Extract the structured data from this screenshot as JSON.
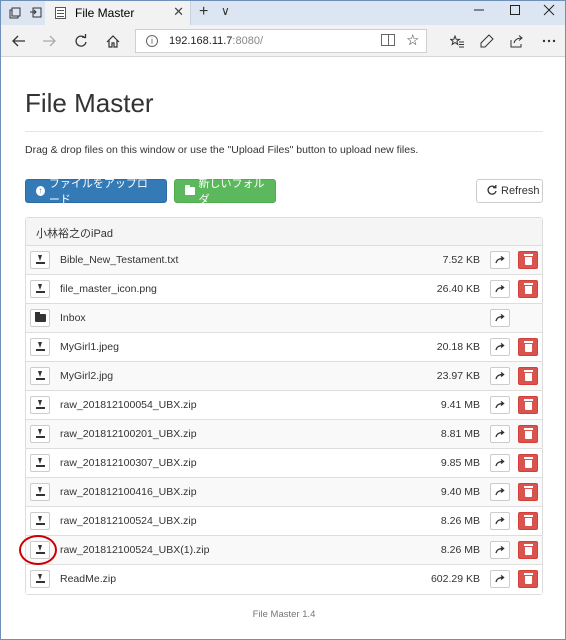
{
  "browser": {
    "tab_title": "File Master",
    "tab_close": "✕",
    "new_tab": "+",
    "tab_menu": "∨",
    "url_host": "192.168.11.7",
    "url_port": ":8080/",
    "info_glyph": "i"
  },
  "page": {
    "title": "File Master",
    "hint": "Drag & drop files on this window or use the \"Upload Files\" button to upload new files.",
    "upload_label": "ファイルをアップロード",
    "new_folder_label": "新しいフォルダ",
    "refresh_label": "Refresh",
    "panel_heading": "小林裕之のiPad",
    "footer": "File Master 1.4"
  },
  "files": [
    {
      "name": "Bible_New_Testament.txt",
      "size": "7.52 KB",
      "type": "file"
    },
    {
      "name": "file_master_icon.png",
      "size": "26.40 KB",
      "type": "file"
    },
    {
      "name": "Inbox",
      "size": "",
      "type": "folder"
    },
    {
      "name": "MyGirl1.jpeg",
      "size": "20.18 KB",
      "type": "file"
    },
    {
      "name": "MyGirl2.jpg",
      "size": "23.97 KB",
      "type": "file"
    },
    {
      "name": "raw_201812100054_UBX.zip",
      "size": "9.41 MB",
      "type": "file"
    },
    {
      "name": "raw_201812100201_UBX.zip",
      "size": "8.81 MB",
      "type": "file"
    },
    {
      "name": "raw_201812100307_UBX.zip",
      "size": "9.85 MB",
      "type": "file"
    },
    {
      "name": "raw_201812100416_UBX.zip",
      "size": "9.40 MB",
      "type": "file"
    },
    {
      "name": "raw_201812100524_UBX.zip",
      "size": "8.26 MB",
      "type": "file"
    },
    {
      "name": "raw_201812100524_UBX(1).zip",
      "size": "8.26 MB",
      "type": "file"
    },
    {
      "name": "ReadMe.zip",
      "size": "602.29 KB",
      "type": "file"
    }
  ],
  "colors": {
    "primary": "#337ab7",
    "success": "#5cb85c",
    "danger": "#d9534f",
    "highlight_circle": "#cc0000"
  }
}
